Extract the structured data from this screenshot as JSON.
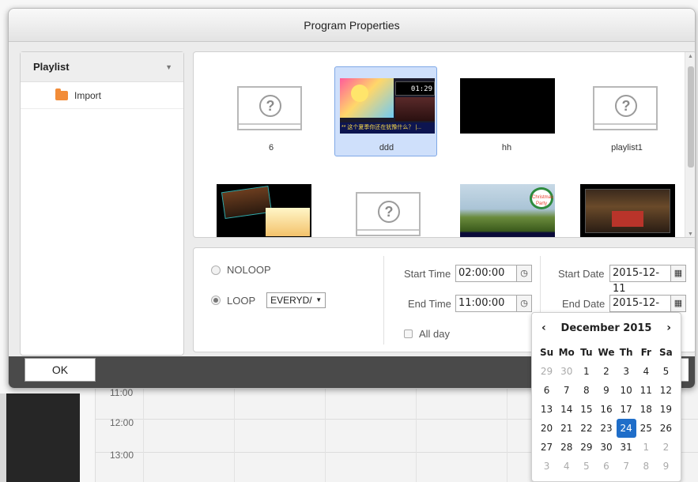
{
  "dialog": {
    "title": "Program Properties"
  },
  "playlist": {
    "header": "Playlist",
    "items": [
      {
        "label": "Import",
        "icon": "folder-icon"
      }
    ]
  },
  "thumbnails": [
    {
      "label": "6",
      "kind": "placeholder",
      "selected": false
    },
    {
      "label": "ddd",
      "kind": "image",
      "selected": true,
      "overlay_time": "01:29",
      "caption": "** 这个夏季你还在犹豫什么？ |..."
    },
    {
      "label": "hh",
      "kind": "black",
      "selected": false
    },
    {
      "label": "playlist1",
      "kind": "placeholder",
      "selected": false
    },
    {
      "label": "",
      "kind": "image",
      "selected": false
    },
    {
      "label": "",
      "kind": "placeholder",
      "selected": false
    },
    {
      "label": "",
      "kind": "image",
      "selected": false,
      "caption": "Christmas Party"
    },
    {
      "label": "",
      "kind": "image",
      "selected": false
    }
  ],
  "options": {
    "noloop_label": "NOLOOP",
    "loop_label": "LOOP",
    "loop_selected": true,
    "loop_mode": "EVERYD/",
    "start_time_label": "Start Time",
    "start_time": "02:00:00",
    "end_time_label": "End Time",
    "end_time": "11:00:00",
    "all_day_label": "All day",
    "start_date_label": "Start Date",
    "start_date": "2015-12-11",
    "end_date_label": "End Date",
    "end_date": "2015-12-24"
  },
  "bottom": {
    "ok_label": "OK"
  },
  "background": {
    "times": [
      "11:00",
      "12:00",
      "13:00"
    ]
  },
  "datepicker": {
    "prev": "‹",
    "next": "›",
    "month": "December 2015",
    "weekdays": [
      "Su",
      "Mo",
      "Tu",
      "We",
      "Th",
      "Fr",
      "Sa"
    ],
    "weeks": [
      [
        {
          "d": "29",
          "m": true
        },
        {
          "d": "30",
          "m": true
        },
        {
          "d": "1"
        },
        {
          "d": "2"
        },
        {
          "d": "3"
        },
        {
          "d": "4"
        },
        {
          "d": "5"
        }
      ],
      [
        {
          "d": "6"
        },
        {
          "d": "7"
        },
        {
          "d": "8"
        },
        {
          "d": "9"
        },
        {
          "d": "10"
        },
        {
          "d": "11"
        },
        {
          "d": "12"
        }
      ],
      [
        {
          "d": "13"
        },
        {
          "d": "14"
        },
        {
          "d": "15"
        },
        {
          "d": "16"
        },
        {
          "d": "17"
        },
        {
          "d": "18"
        },
        {
          "d": "19"
        }
      ],
      [
        {
          "d": "20"
        },
        {
          "d": "21"
        },
        {
          "d": "22"
        },
        {
          "d": "23"
        },
        {
          "d": "24",
          "sel": true
        },
        {
          "d": "25"
        },
        {
          "d": "26"
        }
      ],
      [
        {
          "d": "27"
        },
        {
          "d": "28"
        },
        {
          "d": "29"
        },
        {
          "d": "30"
        },
        {
          "d": "31"
        },
        {
          "d": "1",
          "m": true
        },
        {
          "d": "2",
          "m": true
        }
      ],
      [
        {
          "d": "3",
          "m": true
        },
        {
          "d": "4",
          "m": true
        },
        {
          "d": "5",
          "m": true
        },
        {
          "d": "6",
          "m": true
        },
        {
          "d": "7",
          "m": true
        },
        {
          "d": "8",
          "m": true
        },
        {
          "d": "9",
          "m": true
        }
      ]
    ],
    "selected_color": "#1f6ec9"
  }
}
